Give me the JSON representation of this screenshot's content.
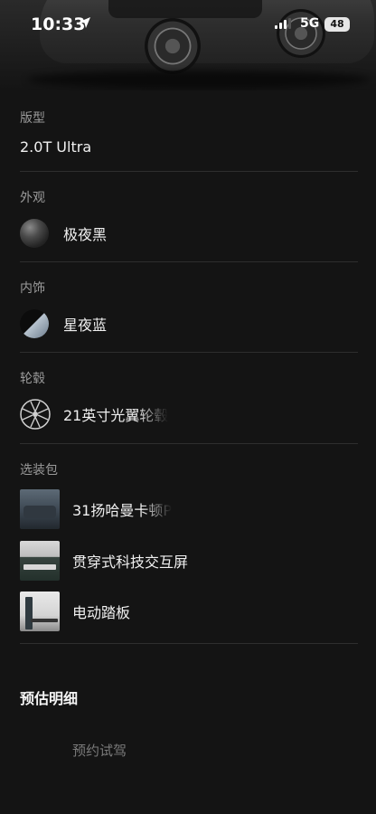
{
  "status_bar": {
    "time": "10:33",
    "network": "5G",
    "battery": "48",
    "location_icon": "location-arrow-icon",
    "signal_icon": "cellular-signal-icon"
  },
  "config": {
    "version": {
      "label": "版型",
      "value": "2.0T Ultra"
    },
    "exterior": {
      "label": "外观",
      "value": "极夜黑",
      "swatch_color": "#2a2a2a"
    },
    "interior": {
      "label": "内饰",
      "value": "星夜蓝",
      "swatch_colors": [
        "#0c0c0c",
        "#b8c4cf"
      ]
    },
    "wheels": {
      "label": "轮毂",
      "value": "21英寸光翼轮毂",
      "icon": "wheel-rim-icon"
    },
    "packages": {
      "label": "选装包",
      "items": [
        {
          "label": "31扬哈曼卡顿P"
        },
        {
          "label": "贯穿式科技交互屏"
        },
        {
          "label": "电动踏板"
        }
      ]
    }
  },
  "estimate": {
    "title": "预估明细"
  },
  "footer": {
    "test_drive": "预约试驾"
  }
}
